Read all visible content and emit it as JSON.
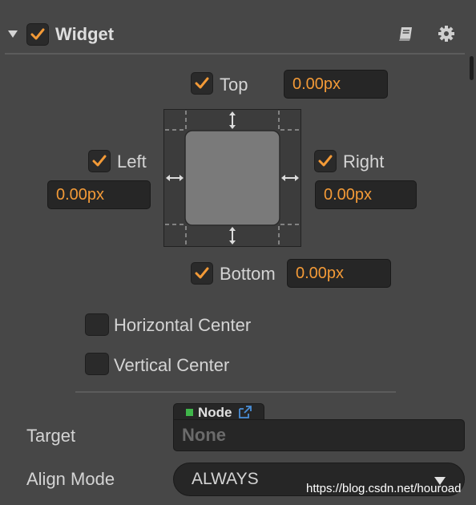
{
  "component": {
    "title": "Widget",
    "enabled": true,
    "collapse_icon": "triangle-down-icon",
    "help_icon": "book-icon",
    "settings_icon": "gear-icon"
  },
  "alignment": {
    "top": {
      "label": "Top",
      "checked": true,
      "value": "0.00px"
    },
    "left": {
      "label": "Left",
      "checked": true,
      "value": "0.00px"
    },
    "right": {
      "label": "Right",
      "checked": true,
      "value": "0.00px"
    },
    "bottom": {
      "label": "Bottom",
      "checked": true,
      "value": "0.00px"
    },
    "horizontal_center": {
      "label": "Horizontal Center",
      "checked": false
    },
    "vertical_center": {
      "label": "Vertical Center",
      "checked": false
    }
  },
  "target": {
    "label": "Target",
    "type_tag": "Node",
    "value": "None"
  },
  "align_mode": {
    "label": "Align Mode",
    "value": "ALWAYS"
  },
  "watermark": "https://blog.csdn.net/houroad",
  "colors": {
    "accent": "#f39a37",
    "background": "#474747",
    "field_bg": "#262626",
    "node_tag_green": "#3fb54a",
    "link_blue": "#4a8fd8"
  }
}
